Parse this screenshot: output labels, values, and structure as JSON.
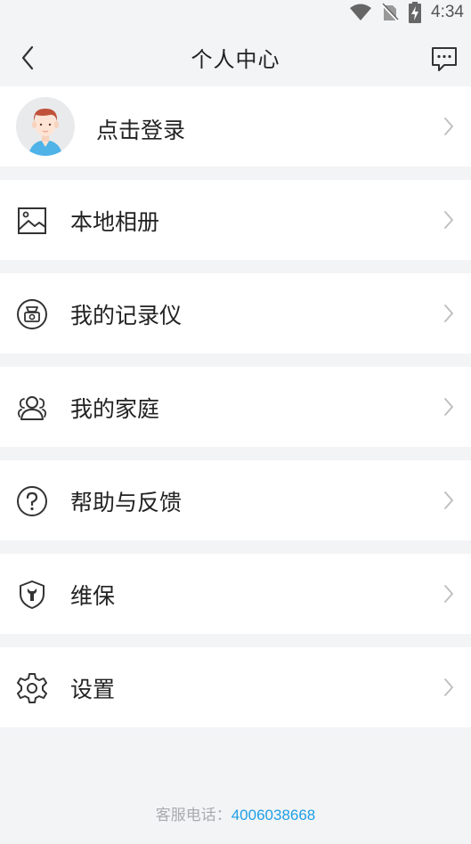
{
  "status_bar": {
    "time": "4:34"
  },
  "nav": {
    "title": "个人中心"
  },
  "profile": {
    "label": "点击登录"
  },
  "menu": [
    {
      "label": "本地相册",
      "icon": "image-icon"
    },
    {
      "label": "我的记录仪",
      "icon": "dashcam-icon"
    },
    {
      "label": "我的家庭",
      "icon": "family-icon"
    },
    {
      "label": "帮助与反馈",
      "icon": "help-icon"
    },
    {
      "label": "维保",
      "icon": "maintenance-shield-icon"
    },
    {
      "label": "设置",
      "icon": "gear-icon"
    }
  ],
  "footer": {
    "label": "客服电话：",
    "phone": "4006038668"
  },
  "colors": {
    "accent": "#1ea0e6",
    "background": "#f3f4f6",
    "card": "#ffffff"
  }
}
